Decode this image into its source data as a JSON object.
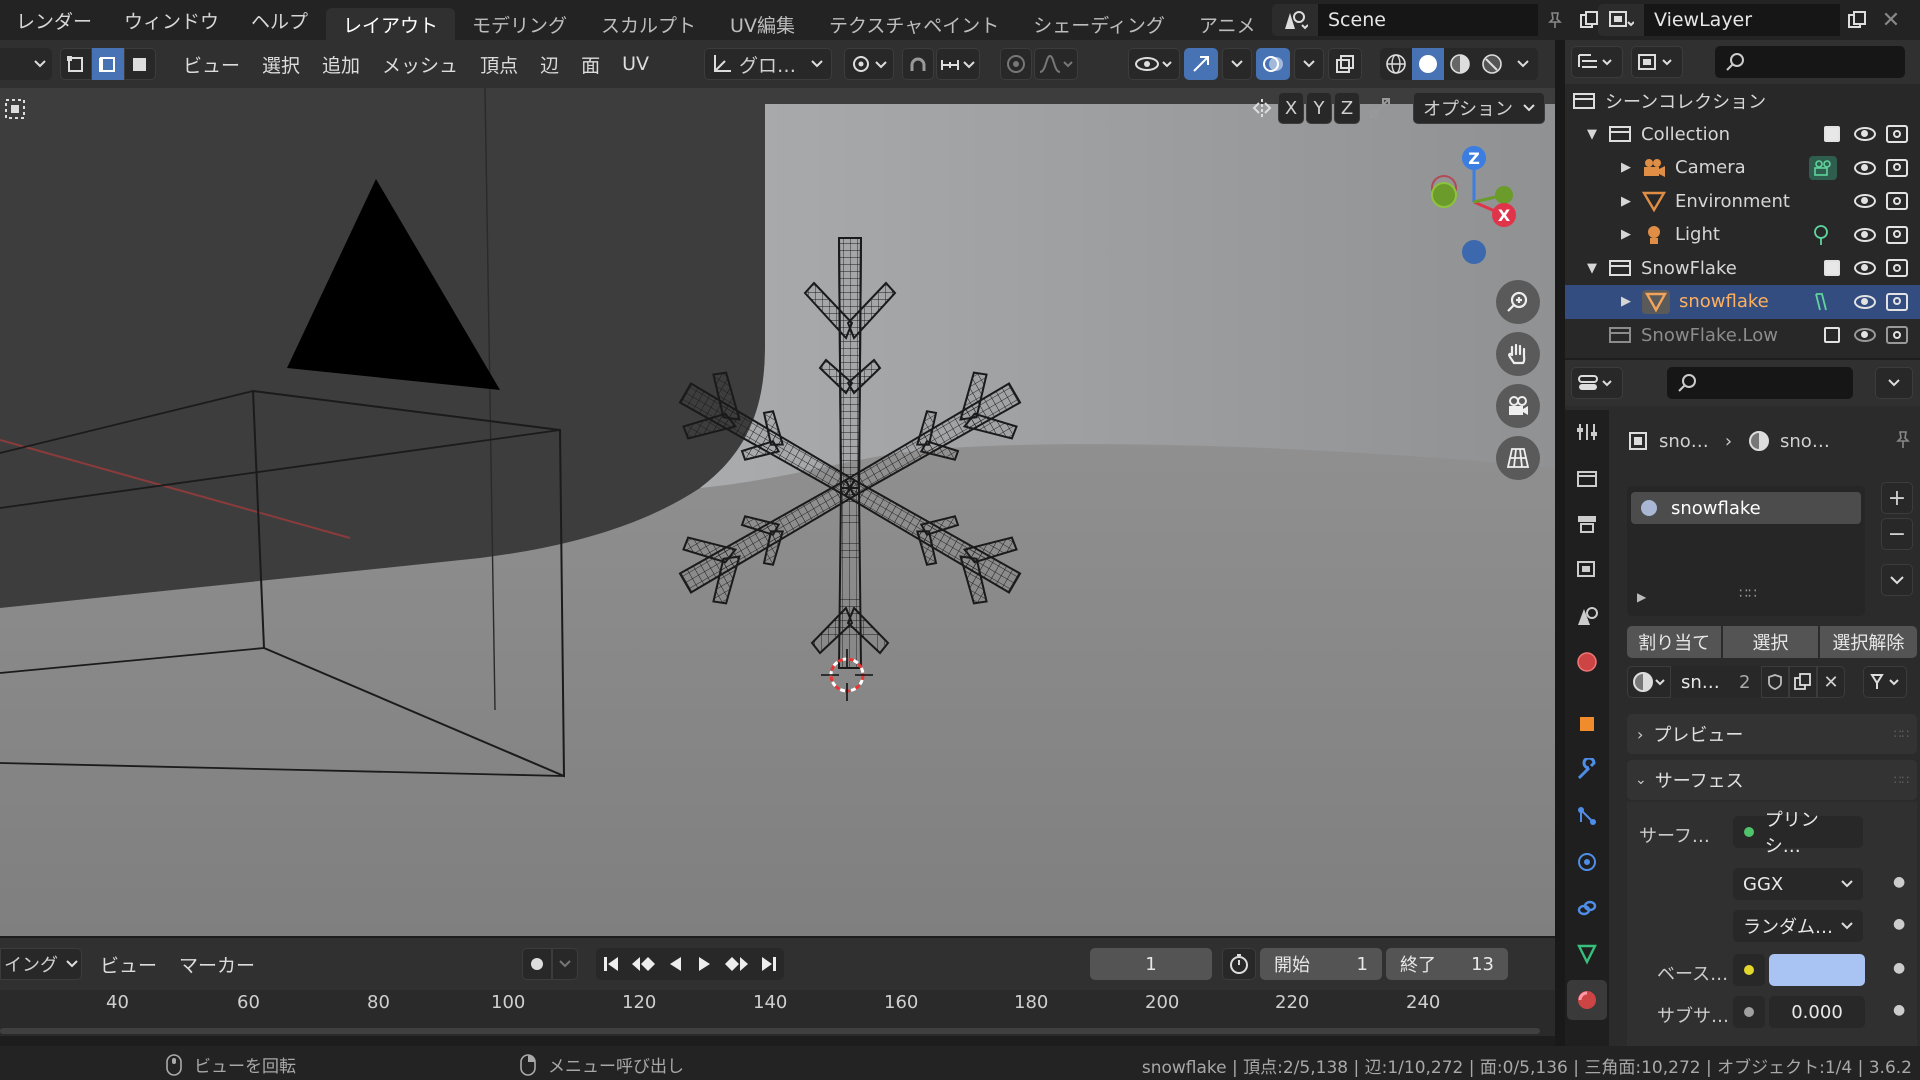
{
  "topbar": {
    "menus": [
      "レンダー",
      "ウィンドウ",
      "ヘルプ"
    ],
    "workspaces": [
      "レイアウト",
      "モデリング",
      "スカルプト",
      "UV編集",
      "テクスチャペイント",
      "シェーディング",
      "アニメーシ"
    ],
    "active_workspace": "レイアウト",
    "scene_name": "Scene",
    "view_layer": "ViewLayer"
  },
  "viewport_header": {
    "menus": [
      "ビュー",
      "選択",
      "追加",
      "メッシュ",
      "頂点",
      "辺",
      "面",
      "UV"
    ],
    "transform_orientation": "グロ…",
    "axis_labels": [
      "X",
      "Y",
      "Z"
    ],
    "options_label": "オプション"
  },
  "gizmo": {
    "z": "Z",
    "x": "X"
  },
  "timeline": {
    "menus": [
      "イング",
      "ビュー",
      "マーカー"
    ],
    "current_frame": "1",
    "start_label": "開始",
    "start_value": "1",
    "end_label": "終了",
    "end_value": "13",
    "ruler_ticks": [
      "40",
      "60",
      "80",
      "100",
      "120",
      "140",
      "160",
      "180",
      "200",
      "220",
      "240"
    ]
  },
  "outliner": {
    "root": "シーンコレクション",
    "items": [
      {
        "label": "Collection",
        "level": 1,
        "type": "collection"
      },
      {
        "label": "Camera",
        "level": 2,
        "type": "camera"
      },
      {
        "label": "Environment",
        "level": 2,
        "type": "mesh"
      },
      {
        "label": "Light",
        "level": 2,
        "type": "light"
      },
      {
        "label": "SnowFlake",
        "level": 1,
        "type": "collection"
      },
      {
        "label": "snowflake",
        "level": 2,
        "type": "mesh",
        "selected": true
      },
      {
        "label": "SnowFlake.Low",
        "level": 1,
        "type": "collection",
        "dim": true
      }
    ]
  },
  "properties": {
    "breadcrumb_object": "sno…",
    "breadcrumb_material": "sno…",
    "material_slot": "snowflake",
    "assign_button": "割り当て",
    "select_button": "選択",
    "deselect_button": "選択解除",
    "material_name": "sn…",
    "user_count": "2",
    "preview_panel": "プレビュー",
    "surface_panel": "サーフェス",
    "surface_label": "サーフ…",
    "surface_value": "プリンシ…",
    "distribution": "GGX",
    "subsurface_method": "ランダム…",
    "base_color_label": "ベース…",
    "base_color": "#a9c3f3",
    "subsurface_label": "サブサ…",
    "subsurface_value": "0.000"
  },
  "statusbar": {
    "hint1": "ビューを回転",
    "hint2": "メニュー呼び出し",
    "stats": "snowflake | 頂点:2/5,138 | 辺:1/10,272 | 面:0/5,136 | 三角面:10,272 | オブジェクト:1/4 | 3.6.2"
  }
}
